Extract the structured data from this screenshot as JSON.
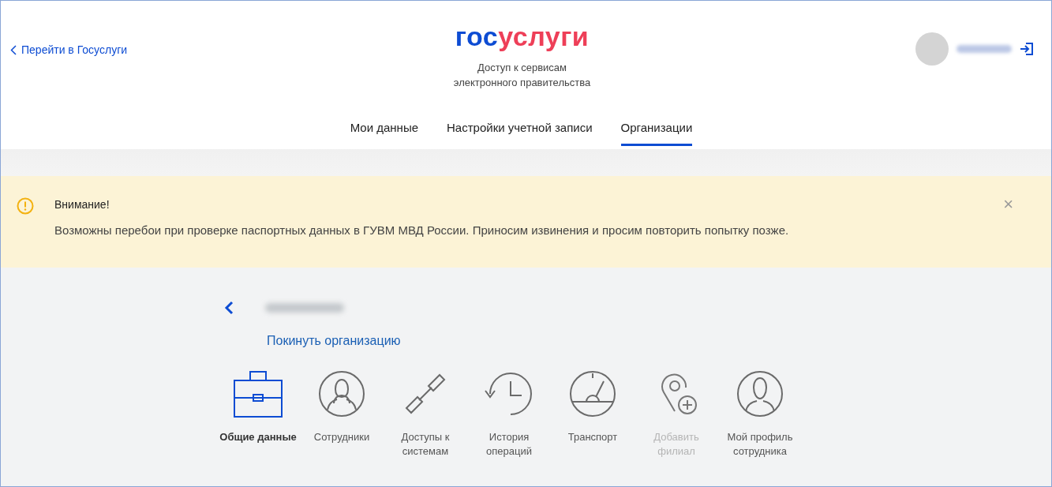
{
  "header": {
    "back_link": "Перейти в Госуслуги",
    "logo": {
      "first": "гос",
      "second": "услуги"
    },
    "subtitle": "Доступ к сервисам электронного правительства"
  },
  "tabs": [
    {
      "label": "Мои данные",
      "selected": false
    },
    {
      "label": "Настройки учетной записи",
      "selected": false
    },
    {
      "label": "Организации",
      "selected": true
    }
  ],
  "alert": {
    "title": "Внимание!",
    "message": "Возможны перебои при проверке паспортных данных в ГУВМ МВД России. Приносим извинения и просим повторить попытку позже.",
    "close": "×"
  },
  "organization": {
    "leave_link": "Покинуть организацию"
  },
  "sections": [
    {
      "kind": "briefcase",
      "label": "Общие данные",
      "selected": true,
      "disabled": false
    },
    {
      "kind": "people",
      "label": "Сотрудники",
      "selected": false,
      "disabled": false
    },
    {
      "kind": "link",
      "label": "Доступы к системам",
      "selected": false,
      "disabled": false
    },
    {
      "kind": "history",
      "label": "История операций",
      "selected": false,
      "disabled": false
    },
    {
      "kind": "gauge",
      "label": "Транспорт",
      "selected": false,
      "disabled": false
    },
    {
      "kind": "pin",
      "label": "Добавить филиал",
      "selected": false,
      "disabled": true
    },
    {
      "kind": "person",
      "label": "Мой профиль сотрудника",
      "selected": false,
      "disabled": false
    }
  ]
}
